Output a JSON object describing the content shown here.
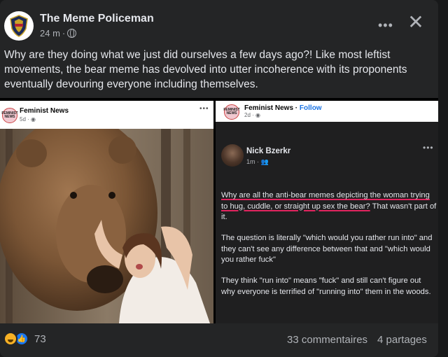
{
  "post": {
    "author": "The Meme Policeman",
    "time": "24 m",
    "text": "Why are they doing what we just did ourselves a few days ago?! Like most leftist movements, the bear meme has devolved into utter incoherence with its proponents eventually devouring everyone including themselves."
  },
  "shared_left": {
    "page_name": "Feminist News",
    "avatar_text": "FEMINIST NEWS",
    "time": "5d"
  },
  "shared_right": {
    "page_name": "Feminist News",
    "follow_label": "Follow",
    "avatar_text": "FEMINIST NEWS",
    "time": "2d",
    "commenter": "Nick Bzerkr",
    "comment_time": "1m",
    "comment_p1_highlight": "Why are all the anti-bear memes depicting the woman trying to hug, cuddle, or straight up sex the bear?",
    "comment_p1_rest": " That wasn't part of it.",
    "comment_p2": "The question is literally \"which would you rather run into\" and they can't see any difference between that and \"which would you rather fuck\"",
    "comment_p3": "They think \"run into\" means \"fuck\" and still can't figure out why everyone is terrified of \"running into\" them in the woods."
  },
  "footer": {
    "reaction_count": "73",
    "comments": "33 commentaires",
    "shares": "4 partages"
  },
  "icons": {
    "more": "more-icon",
    "close": "close-icon",
    "globe": "globe-icon",
    "friends": "friends-icon"
  },
  "colors": {
    "background": "#242526",
    "highlight_underline": "#e0245e",
    "follow": "#1b74e4"
  }
}
